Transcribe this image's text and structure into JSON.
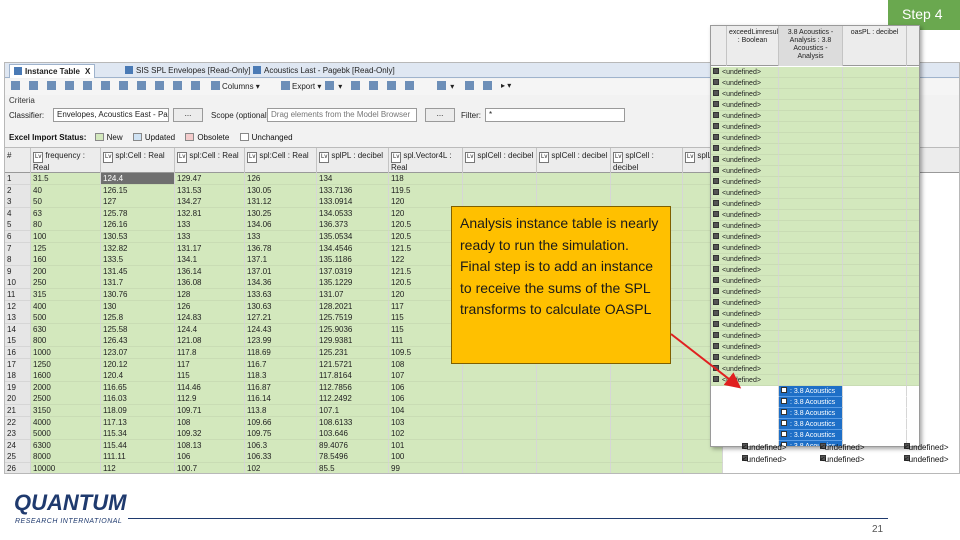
{
  "slide": {
    "step_label": "Step 4",
    "callout_text": "Analysis instance table is nearly ready to run the simulation. Final step is to add an instance to receive the sums of the SPL transforms to calculate OASPL",
    "page_number": "21",
    "logo_main": "QUANTUM",
    "logo_sub": "RESEARCH INTERNATIONAL"
  },
  "tabs": [
    {
      "label": "Instance Table",
      "active": true,
      "close": "X"
    },
    {
      "label": "SIS SPL Envelopes [Read-Only]",
      "active": false,
      "close": ""
    },
    {
      "label": "Acoustics Last - Pagebk [Read-Only]",
      "active": false,
      "close": ""
    }
  ],
  "toolbar": {
    "columns_label": "Columns",
    "export_label": "Export"
  },
  "criteria": {
    "title": "Criteria",
    "classifier_label": "Classifier:",
    "classifier_value": "Envelopes, Acoustics East - Pagebk",
    "browse_label": "...",
    "scope_label": "Scope (optional):",
    "scope_placeholder": "Drag elements from the Model Browser",
    "filter_label": "Filter:",
    "filter_value": "*"
  },
  "import_status": {
    "label": "Excel Import Status:",
    "legend": [
      {
        "label": "New",
        "color": "#d3e8bd"
      },
      {
        "label": "Updated",
        "color": "#cfe2f3"
      },
      {
        "label": "Obsolete",
        "color": "#f4cccc"
      },
      {
        "label": "Unchanged",
        "color": "#ffffff"
      }
    ]
  },
  "table": {
    "columns": [
      "#",
      "frequency : Real",
      "spl:Cell : Real",
      "spl:Cell : Real",
      "spl:Cell : Real",
      "splPL : decibel",
      "spl.Vector4L : Real",
      "splCell : decibel",
      "splCell : decibel",
      "splCell : decibel",
      "splLV"
    ],
    "rows": [
      [
        "1",
        "31.5",
        "124.4",
        "129.47",
        "126",
        "134",
        "118"
      ],
      [
        "2",
        "40",
        "126.15",
        "131.53",
        "130.05",
        "133.7136",
        "119.5"
      ],
      [
        "3",
        "50",
        "127",
        "134.27",
        "131.12",
        "133.0914",
        "120"
      ],
      [
        "4",
        "63",
        "125.78",
        "132.81",
        "130.25",
        "134.0533",
        "120"
      ],
      [
        "5",
        "80",
        "126.16",
        "133",
        "134.06",
        "136.373",
        "120.5"
      ],
      [
        "6",
        "100",
        "130.53",
        "133",
        "133",
        "135.0534",
        "120.5"
      ],
      [
        "7",
        "125",
        "132.82",
        "131.17",
        "136.78",
        "134.4546",
        "121.5"
      ],
      [
        "8",
        "160",
        "133.5",
        "134.1",
        "137.1",
        "135.1186",
        "122"
      ],
      [
        "9",
        "200",
        "131.45",
        "136.14",
        "137.01",
        "137.0319",
        "121.5"
      ],
      [
        "10",
        "250",
        "131.7",
        "136.08",
        "134.36",
        "135.1229",
        "120.5"
      ],
      [
        "11",
        "315",
        "130.76",
        "128",
        "133.63",
        "131.07",
        "120"
      ],
      [
        "12",
        "400",
        "130",
        "126",
        "130.63",
        "128.2021",
        "117"
      ],
      [
        "13",
        "500",
        "125.8",
        "124.83",
        "127.21",
        "125.7519",
        "115"
      ],
      [
        "14",
        "630",
        "125.58",
        "124.4",
        "124.43",
        "125.9036",
        "115"
      ],
      [
        "15",
        "800",
        "126.43",
        "121.08",
        "123.99",
        "129.9381",
        "111"
      ],
      [
        "16",
        "1000",
        "123.07",
        "117.8",
        "118.69",
        "125.231",
        "109.5"
      ],
      [
        "17",
        "1250",
        "120.12",
        "117",
        "116.7",
        "121.5721",
        "108"
      ],
      [
        "18",
        "1600",
        "120.4",
        "115",
        "118.3",
        "117.8164",
        "107"
      ],
      [
        "19",
        "2000",
        "116.65",
        "114.46",
        "116.87",
        "112.7856",
        "106"
      ],
      [
        "20",
        "2500",
        "116.03",
        "112.9",
        "116.14",
        "112.2492",
        "106"
      ],
      [
        "21",
        "3150",
        "118.09",
        "109.71",
        "113.8",
        "107.1",
        "104"
      ],
      [
        "22",
        "4000",
        "117.13",
        "108",
        "109.66",
        "108.6133",
        "103"
      ],
      [
        "23",
        "5000",
        "115.34",
        "109.32",
        "109.75",
        "103.646",
        "102"
      ],
      [
        "24",
        "6300",
        "115.44",
        "108.13",
        "106.3",
        "89.4076",
        "101"
      ],
      [
        "25",
        "8000",
        "111.11",
        "106",
        "106.33",
        "78.5496",
        "100"
      ],
      [
        "26",
        "10000",
        "112",
        "100.7",
        "102",
        "85.5",
        "99"
      ]
    ]
  },
  "panel": {
    "columns": [
      "exceedLimresult : Boolean",
      "3.8 Acoustics - Analysis : 3.8 Acoustics - Analysis",
      "oasPL : decibel"
    ],
    "undefined_label": "<undefined>",
    "acoustics_label": ": 3.8 Acoustics",
    "tail_left": "<undefined>"
  },
  "right_strip": {
    "header": "exceedLimres. : Boolean",
    "cell": "<undefined>"
  }
}
